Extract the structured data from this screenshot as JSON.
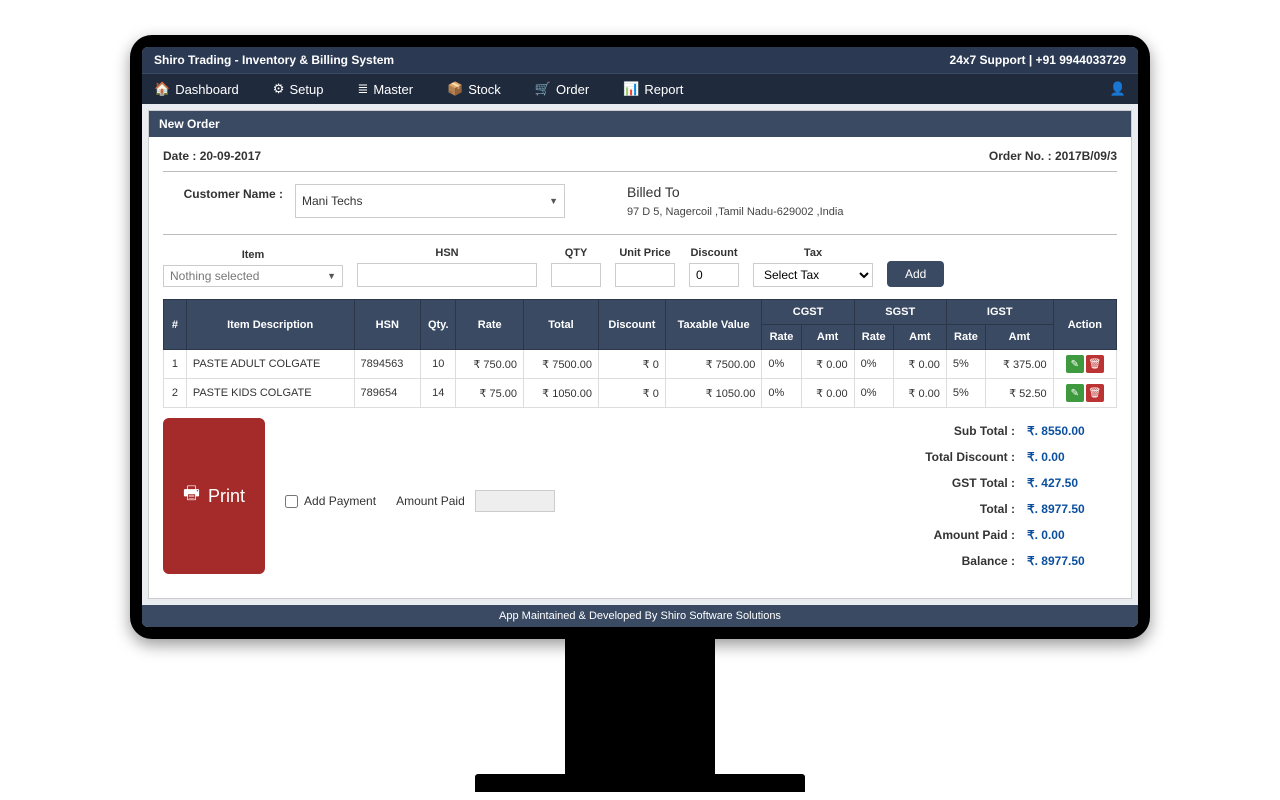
{
  "titlebar": {
    "left": "Shiro Trading - Inventory & Billing System",
    "right": "24x7 Support | +91 9944033729"
  },
  "nav": {
    "dashboard": "Dashboard",
    "setup": "Setup",
    "master": "Master",
    "stock": "Stock",
    "order": "Order",
    "report": "Report"
  },
  "panel": {
    "title": "New Order"
  },
  "meta": {
    "date_label": "Date : ",
    "date": "20-09-2017",
    "orderno_label": "Order No. : ",
    "orderno": "2017B/09/3"
  },
  "customer": {
    "label": "Customer Name :",
    "selected": "Mani Techs",
    "billed_to_heading": "Billed To",
    "address": "97 D 5, Nagercoil ,Tamil Nadu-629002 ,India"
  },
  "entry": {
    "labels": {
      "item": "Item",
      "hsn": "HSN",
      "qty": "QTY",
      "unit_price": "Unit Price",
      "discount": "Discount",
      "tax": "Tax"
    },
    "item_placeholder": "Nothing selected",
    "discount_default": "0",
    "tax_placeholder": "Select Tax",
    "add_btn": "Add"
  },
  "table": {
    "head": {
      "num": "#",
      "desc": "Item Description",
      "hsn": "HSN",
      "qty": "Qty.",
      "rate": "Rate",
      "total": "Total",
      "discount": "Discount",
      "taxable": "Taxable Value",
      "cgst": "CGST",
      "sgst": "SGST",
      "igst": "IGST",
      "action": "Action",
      "sub_rate": "Rate",
      "sub_amt": "Amt"
    },
    "rows": [
      {
        "n": "1",
        "desc": "PASTE ADULT COLGATE",
        "hsn": "7894563",
        "qty": "10",
        "rate": "750.00",
        "total": "7500.00",
        "disc": "0",
        "taxable": "7500.00",
        "cgst_rate": "0%",
        "cgst_amt": "0.00",
        "sgst_rate": "0%",
        "sgst_amt": "0.00",
        "igst_rate": "5%",
        "igst_amt": "375.00"
      },
      {
        "n": "2",
        "desc": "PASTE KIDS COLGATE",
        "hsn": "789654",
        "qty": "14",
        "rate": "75.00",
        "total": "1050.00",
        "disc": "0",
        "taxable": "1050.00",
        "cgst_rate": "0%",
        "cgst_amt": "0.00",
        "sgst_rate": "0%",
        "sgst_amt": "0.00",
        "igst_rate": "5%",
        "igst_amt": "52.50"
      }
    ]
  },
  "actions": {
    "print": "Print",
    "add_payment": "Add Payment",
    "amount_paid_label": "Amount Paid"
  },
  "totals": {
    "labels": {
      "sub": "Sub Total :",
      "disc": "Total Discount :",
      "gst": "GST Total :",
      "total": "Total :",
      "paid": "Amount Paid :",
      "bal": "Balance :"
    },
    "values": {
      "sub": "₹. 8550.00",
      "disc": "₹. 0.00",
      "gst": "₹. 427.50",
      "total": "₹. 8977.50",
      "paid": "₹. 0.00",
      "bal": "₹. 8977.50"
    }
  },
  "footer": "App Maintained & Developed By Shiro Software Solutions",
  "glyphs": {
    "rupee": "₹"
  }
}
